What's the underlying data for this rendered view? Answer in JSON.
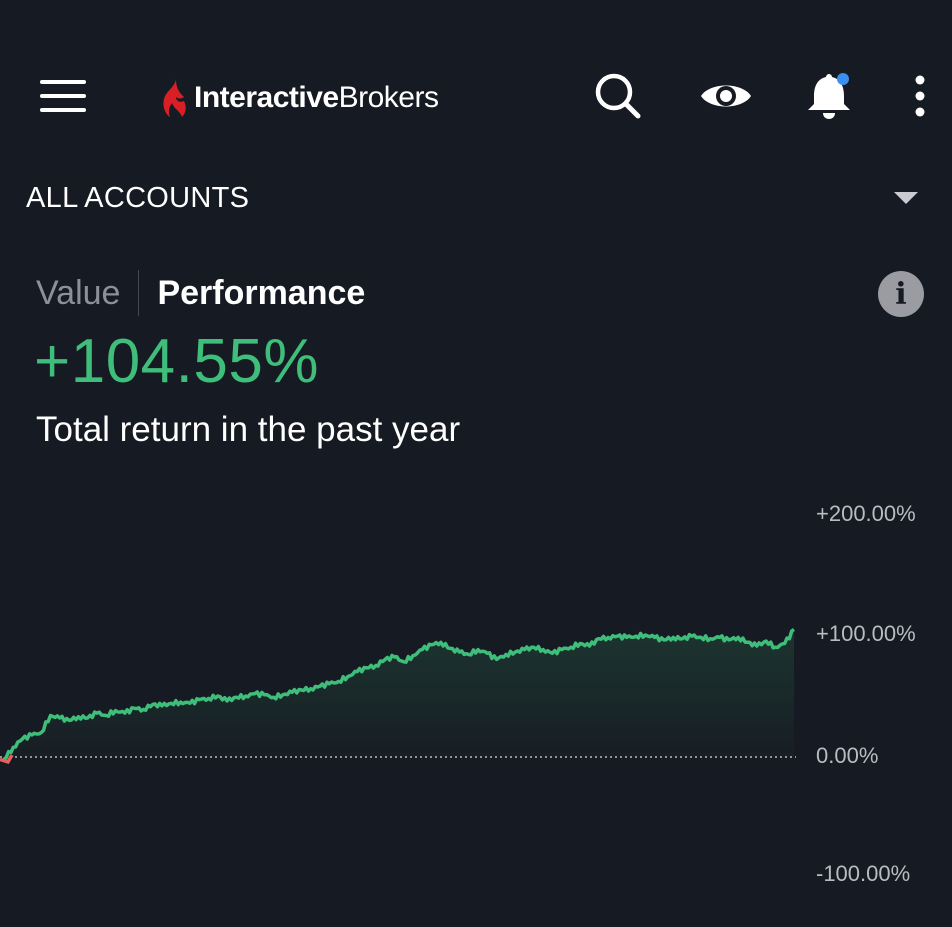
{
  "header": {
    "logo_text_bold": "Interactive",
    "logo_text_regular": "Brokers",
    "icons": [
      "menu-icon",
      "search-icon",
      "eye-icon",
      "bell-icon",
      "more-vertical-icon"
    ],
    "notification_dot_color": "#3b8ff0"
  },
  "accounts": {
    "label": "ALL ACCOUNTS"
  },
  "tabs": {
    "value": "Value",
    "performance": "Performance",
    "selected": "Performance"
  },
  "summary": {
    "total_return": "+104.55%",
    "caption": "Total return in the past year"
  },
  "colors": {
    "background": "#161a22",
    "positive": "#3fbd7a",
    "negative": "#e9605f",
    "brand_red": "#d81f26"
  },
  "chart_data": {
    "type": "area",
    "y_ticks": [
      "+200.00%",
      "+100.00%",
      "0.00%",
      "-100.00%"
    ],
    "ylim": [
      -100,
      200
    ],
    "baseline": 0,
    "series": [
      {
        "values": [
          -2,
          8,
          15,
          18,
          20,
          34,
          32,
          30,
          33,
          32,
          36,
          34,
          38,
          36,
          40,
          39,
          43,
          42,
          44,
          45,
          44,
          47,
          48,
          50,
          46,
          49,
          50,
          52,
          51,
          49,
          51,
          53,
          55,
          56,
          58,
          60,
          62,
          66,
          70,
          73,
          75,
          80,
          82,
          78,
          83,
          88,
          92,
          94,
          89,
          86,
          84,
          88,
          85,
          80,
          84,
          86,
          88,
          90,
          88,
          85,
          88,
          90,
          93,
          91,
          97,
          98,
          99,
          98,
          99,
          100,
          98,
          96,
          98,
          97,
          99,
          98,
          97,
          98,
          96,
          98,
          94,
          91,
          95,
          90,
          93,
          104.55
        ]
      }
    ]
  }
}
